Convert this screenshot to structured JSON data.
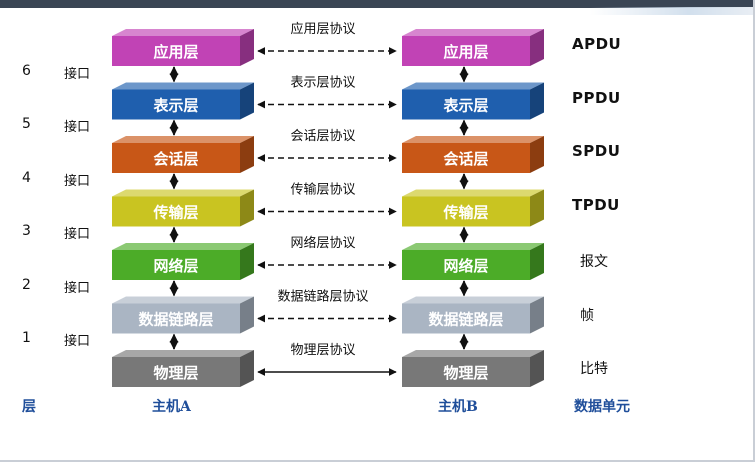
{
  "host_a": {
    "label": "主机A"
  },
  "host_b": {
    "label": "主机B"
  },
  "left_header": "层",
  "right_header": "数据单元",
  "interface_label": "接口",
  "layers": [
    {
      "name": "应用层",
      "color": "#c143b5",
      "protocol": "应用层协议",
      "unit": "APDU",
      "dashed": true
    },
    {
      "name": "表示层",
      "color": "#1f5fae",
      "protocol": "表示层协议",
      "unit": "PPDU",
      "dashed": true
    },
    {
      "name": "会话层",
      "color": "#c85717",
      "protocol": "会话层协议",
      "unit": "SPDU",
      "dashed": true
    },
    {
      "name": "传输层",
      "color": "#c9c421",
      "protocol": "传输层协议",
      "unit": "TPDU",
      "dashed": true
    },
    {
      "name": "网络层",
      "color": "#4cac28",
      "protocol": "网络层协议",
      "unit": "报文",
      "dashed": true
    },
    {
      "name": "数据链路层",
      "color": "#aab5c3",
      "protocol": "数据链路层协议",
      "unit": "帧",
      "dashed": true
    },
    {
      "name": "物理层",
      "color": "#787878",
      "protocol": "物理层协议",
      "unit": "比特",
      "dashed": false
    }
  ],
  "interfaces": [
    "6",
    "5",
    "4",
    "3",
    "2",
    "1"
  ]
}
